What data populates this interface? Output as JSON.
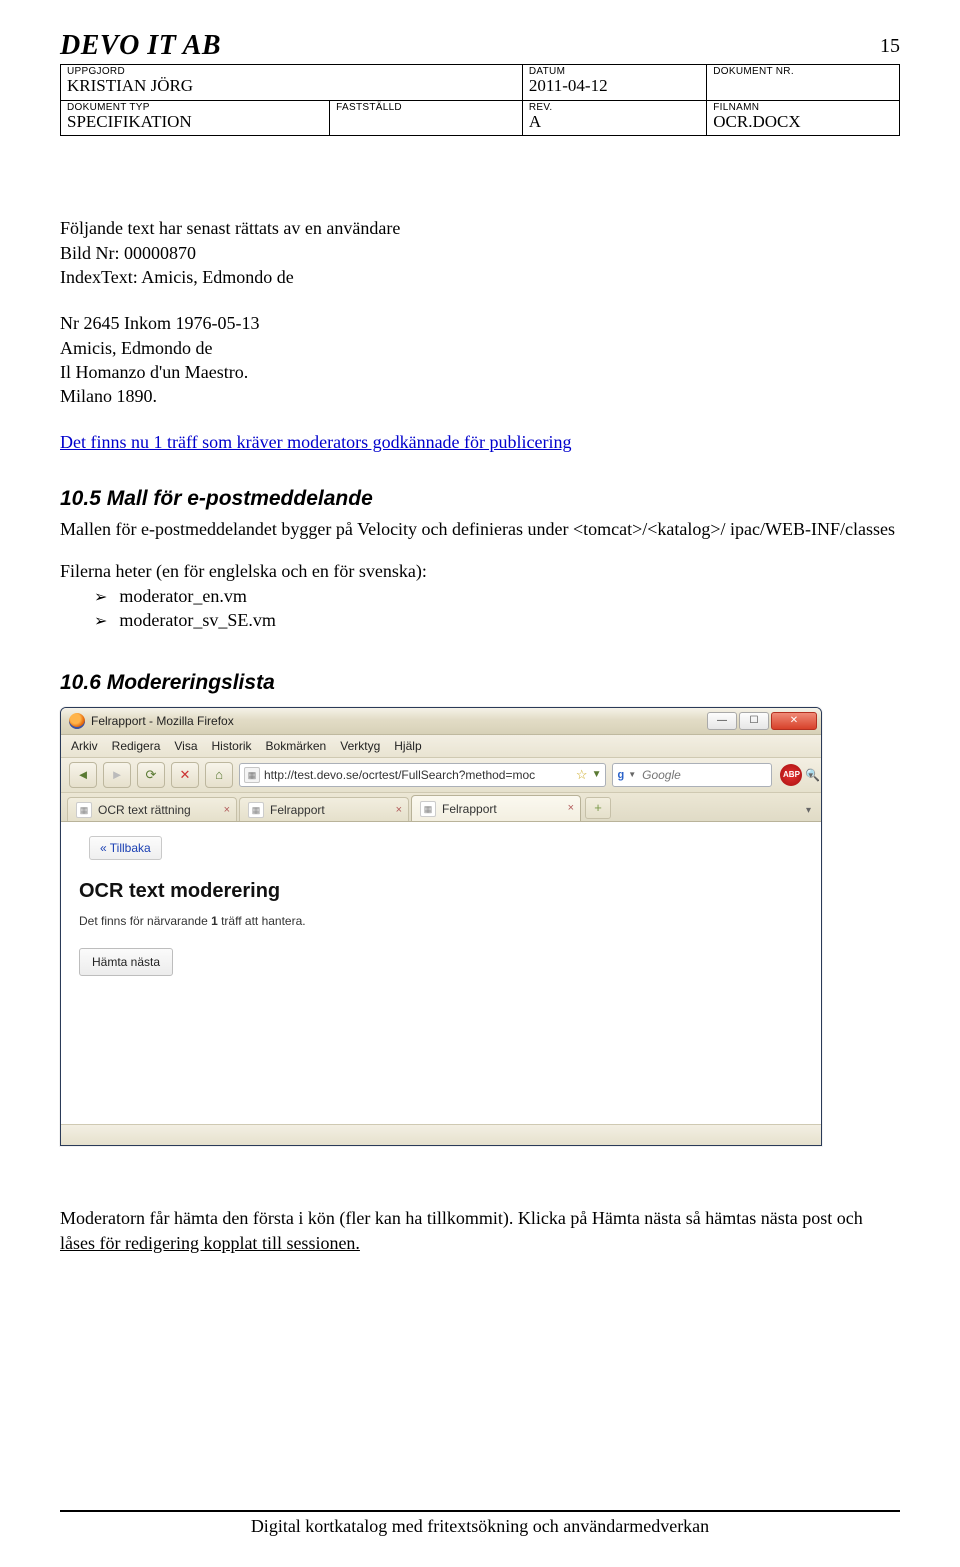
{
  "header": {
    "company": "DEVO IT AB",
    "page_number": "15",
    "row1": {
      "uppgjord_label": "UPPGJORD",
      "uppgjord_value": "KRISTIAN JÖRG",
      "datum_label": "DATUM",
      "datum_value": "2011-04-12",
      "doknr_label": "DOKUMENT NR."
    },
    "row2": {
      "doktyp_label": "DOKUMENT TYP",
      "doktyp_value": "SPECIFIKATION",
      "faststalld_label": "FASTSTÄLLD",
      "rev_label": "REV.",
      "rev_value": "A",
      "filnamn_label": "FILNAMN",
      "filnamn_value": "OCR.DOCX"
    }
  },
  "body": {
    "intro": "Följande text har senast rättats av en användare",
    "bild_line": "Bild Nr: 00000870",
    "index_line": "IndexText: Amicis, Edmondo de",
    "ref_lines": [
      "Nr 2645 Inkom 1976-05-13",
      "Amicis, Edmondo de",
      "Il Homanzo d'un Maestro.",
      "Milano 1890."
    ],
    "link_text": "Det finns nu 1 träff som kräver moderators godkännade för publicering",
    "h105": "10.5 Mall för e-postmeddelande",
    "p105a": "Mallen för e-postmeddelandet bygger på Velocity och definieras under <tomcat>/<katalog>/ ipac/WEB-INF/classes",
    "p105b": "Filerna heter (en för englelska och en för svenska):",
    "files": [
      "moderator_en.vm",
      "moderator_sv_SE.vm"
    ],
    "h106": "10.6 Modereringslista",
    "after1": "Moderatorn får hämta den första i kön (fler kan ha tillkommit). Klicka på Hämta nästa så hämtas nästa post och ",
    "after1_u": "låses för redigering kopplat till sessionen.",
    "footer": "Digital kortkatalog med fritextsökning och användarmedverkan"
  },
  "shot": {
    "title": "Felrapport - Mozilla Firefox",
    "menus": [
      "Arkiv",
      "Redigera",
      "Visa",
      "Historik",
      "Bokmärken",
      "Verktyg",
      "Hjälp"
    ],
    "url": "http://test.devo.se/ocrtest/FullSearch?method=moc",
    "search_placeholder": "Google",
    "abp": "ABP",
    "tabs": [
      {
        "label": "OCR text rättning",
        "active": false
      },
      {
        "label": "Felrapport",
        "active": false
      },
      {
        "label": "Felrapport",
        "active": true
      }
    ],
    "back": "« Tillbaka",
    "h1": "OCR text moderering",
    "msg_pre": "Det finns för närvarande ",
    "msg_bold": "1",
    "msg_post": " träff att hantera.",
    "btn": "Hämta nästa"
  }
}
